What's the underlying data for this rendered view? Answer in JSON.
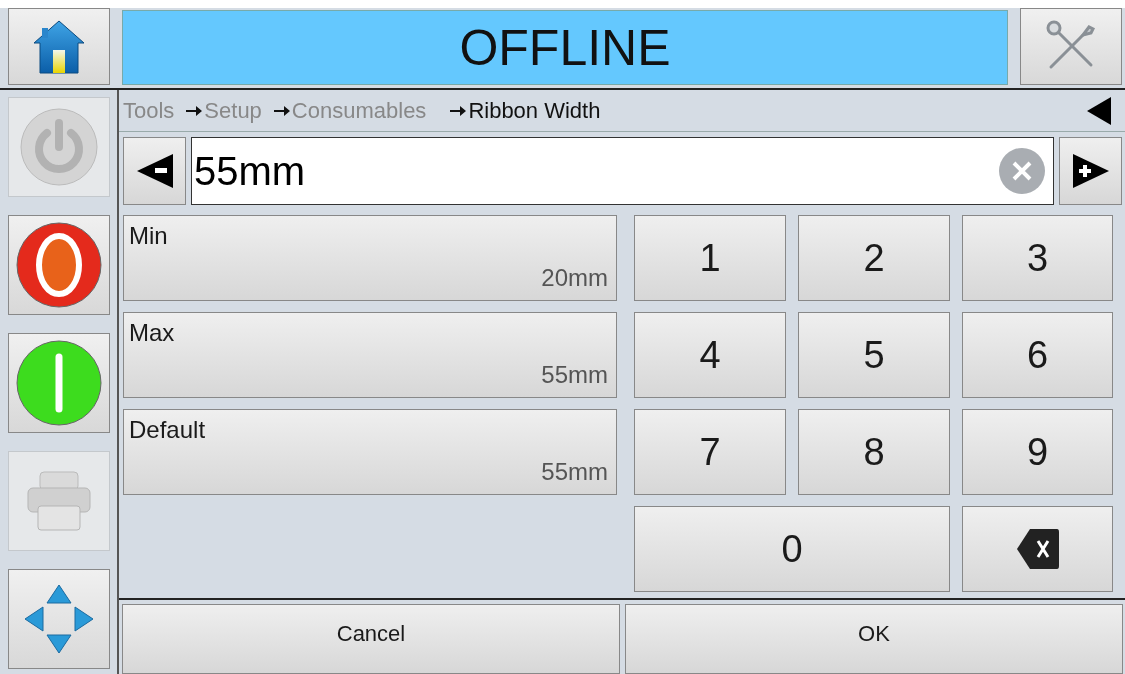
{
  "status": {
    "text": "OFFLINE"
  },
  "sidebar": [
    {
      "kind": "power",
      "disabled": true
    },
    {
      "kind": "stop",
      "disabled": false
    },
    {
      "kind": "start",
      "disabled": false
    },
    {
      "kind": "print",
      "disabled": true
    },
    {
      "kind": "navigate",
      "disabled": false
    }
  ],
  "breadcrumb": [
    {
      "label": "Tools",
      "current": false
    },
    {
      "label": "Setup",
      "current": false
    },
    {
      "label": "Consumables",
      "current": false
    },
    {
      "label": "Ribbon Width",
      "current": true
    }
  ],
  "entry": {
    "value": "55mm"
  },
  "presets": [
    {
      "label": "Min",
      "value": "20mm"
    },
    {
      "label": "Max",
      "value": "55mm"
    },
    {
      "label": "Default",
      "value": "55mm"
    }
  ],
  "keypad": [
    {
      "kind": "digit",
      "label": "1"
    },
    {
      "kind": "digit",
      "label": "2"
    },
    {
      "kind": "digit",
      "label": "3"
    },
    {
      "kind": "digit",
      "label": "4"
    },
    {
      "kind": "digit",
      "label": "5"
    },
    {
      "kind": "digit",
      "label": "6"
    },
    {
      "kind": "digit",
      "label": "7"
    },
    {
      "kind": "digit",
      "label": "8"
    },
    {
      "kind": "digit",
      "label": "9"
    },
    {
      "kind": "wide",
      "label": "0"
    },
    {
      "kind": "backspace"
    }
  ],
  "buttons": [
    {
      "label": "Cancel"
    },
    {
      "label": "OK"
    }
  ]
}
